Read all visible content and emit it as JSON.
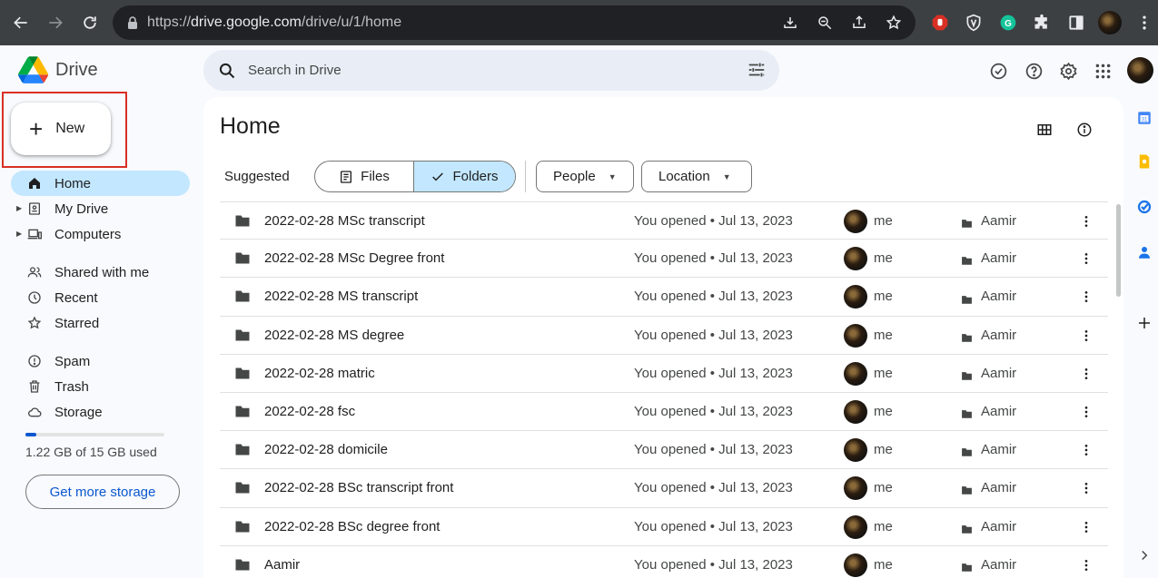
{
  "browser": {
    "url_prefix": "https://",
    "url_host": "drive.google.com",
    "url_path": "/drive/u/1/home"
  },
  "app": {
    "name": "Drive",
    "search_placeholder": "Search in Drive"
  },
  "new_button": {
    "label": "New"
  },
  "sidebar": {
    "items": [
      {
        "label": "Home",
        "icon": "home-icon",
        "active": true
      },
      {
        "label": "My Drive",
        "icon": "my-drive-icon",
        "expandable": true
      },
      {
        "label": "Computers",
        "icon": "computers-icon",
        "expandable": true
      },
      {
        "label": "Shared with me",
        "icon": "shared-icon"
      },
      {
        "label": "Recent",
        "icon": "clock-icon"
      },
      {
        "label": "Starred",
        "icon": "star-icon"
      },
      {
        "label": "Spam",
        "icon": "spam-icon"
      },
      {
        "label": "Trash",
        "icon": "trash-icon"
      },
      {
        "label": "Storage",
        "icon": "cloud-icon"
      }
    ],
    "storage_used_fraction": 0.08,
    "storage_text": "1.22 GB of 15 GB used",
    "more_storage_label": "Get more storage"
  },
  "main": {
    "title": "Home",
    "suggested_label": "Suggested",
    "segment": {
      "files": "Files",
      "folders": "Folders",
      "selected": "Folders"
    },
    "filters": {
      "people": "People",
      "location": "Location"
    },
    "rows": [
      {
        "name": "2022-02-28 MSc transcript",
        "activity": "You opened • Jul 13, 2023",
        "owner": "me",
        "location": "Aamir"
      },
      {
        "name": "2022-02-28 MSc Degree front",
        "activity": "You opened • Jul 13, 2023",
        "owner": "me",
        "location": "Aamir"
      },
      {
        "name": "2022-02-28 MS transcript",
        "activity": "You opened • Jul 13, 2023",
        "owner": "me",
        "location": "Aamir"
      },
      {
        "name": "2022-02-28 MS degree",
        "activity": "You opened • Jul 13, 2023",
        "owner": "me",
        "location": "Aamir"
      },
      {
        "name": "2022-02-28 matric",
        "activity": "You opened • Jul 13, 2023",
        "owner": "me",
        "location": "Aamir"
      },
      {
        "name": "2022-02-28 fsc",
        "activity": "You opened • Jul 13, 2023",
        "owner": "me",
        "location": "Aamir"
      },
      {
        "name": "2022-02-28 domicile",
        "activity": "You opened • Jul 13, 2023",
        "owner": "me",
        "location": "Aamir"
      },
      {
        "name": "2022-02-28 BSc transcript front",
        "activity": "You opened • Jul 13, 2023",
        "owner": "me",
        "location": "Aamir"
      },
      {
        "name": "2022-02-28 BSc degree front",
        "activity": "You opened • Jul 13, 2023",
        "owner": "me",
        "location": "Aamir"
      },
      {
        "name": "Aamir",
        "activity": "You opened • Jul 13, 2023",
        "owner": "me",
        "location": "Aamir"
      }
    ]
  },
  "colors": {
    "accent": "#0b57d0",
    "selected_bg": "#c2e7ff",
    "highlight_border": "#d93025"
  }
}
